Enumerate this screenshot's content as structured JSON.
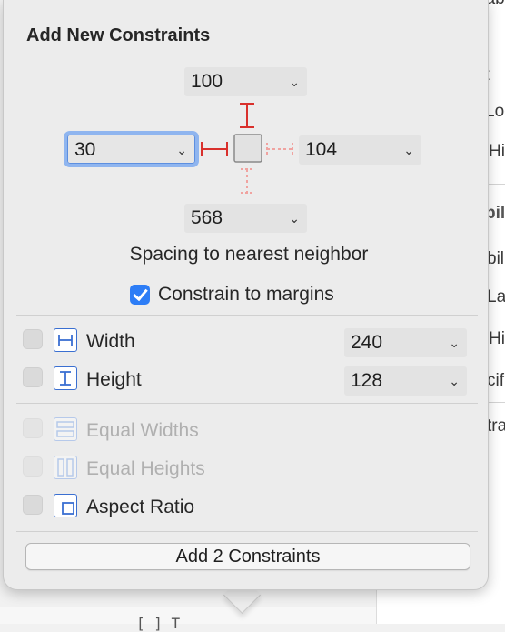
{
  "background": {
    "inspector_fragments": [
      "Lab",
      "ct",
      "Loc",
      "Hi",
      "bili",
      "bili",
      "Lab",
      "Hi",
      "cifi",
      "trai"
    ],
    "bottom_fragment": "[ ]   T"
  },
  "popover": {
    "title": "Add New Constraints",
    "spacing": {
      "top": "100",
      "left": "30",
      "right": "104",
      "bottom": "568",
      "caption": "Spacing to nearest neighbor"
    },
    "constrain_to_margins": {
      "label": "Constrain to margins",
      "checked": true
    },
    "size": {
      "width": {
        "label": "Width",
        "value": "240",
        "checked": false
      },
      "height": {
        "label": "Height",
        "value": "128",
        "checked": false
      }
    },
    "equal_widths": {
      "label": "Equal Widths",
      "enabled": false
    },
    "equal_heights": {
      "label": "Equal Heights",
      "enabled": false
    },
    "aspect_ratio": {
      "label": "Aspect Ratio",
      "checked": false
    },
    "add_button": "Add 2 Constraints"
  },
  "colors": {
    "accent": "#2d7df6",
    "constraint_active": "#d9302c",
    "constraint_inactive": "#f0a3a0",
    "icon_blue": "#3a6fd1"
  },
  "icons": [
    "chevron-down-icon",
    "width-icon",
    "height-icon",
    "equal-widths-icon",
    "equal-heights-icon",
    "aspect-ratio-icon",
    "checkmark-icon"
  ]
}
